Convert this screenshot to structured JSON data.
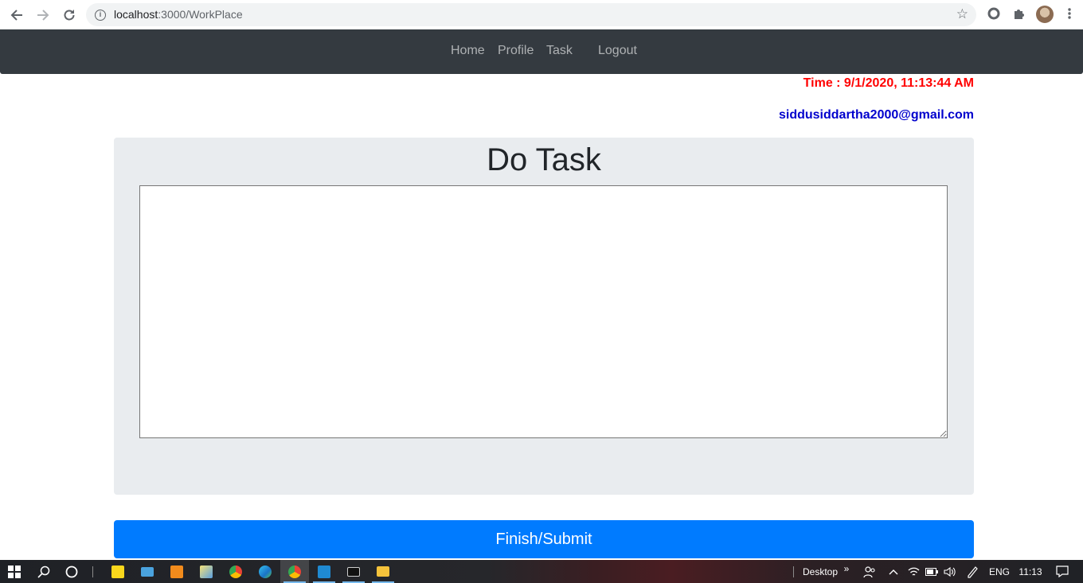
{
  "browser": {
    "url_host": "localhost",
    "url_path": ":3000/WorkPlace"
  },
  "navbar": {
    "links": [
      "Home",
      "Profile",
      "Task",
      "Logout"
    ]
  },
  "status": {
    "time": "Time : 9/1/2020, 11:13:44 AM",
    "email": "siddusiddartha2000@gmail.com"
  },
  "task": {
    "heading": "Do Task",
    "textarea_value": ""
  },
  "submit": {
    "label": "Finish/Submit"
  },
  "colors": {
    "navbar_bg": "#343a40",
    "time_color": "#ff0000",
    "email_color": "#0000cd",
    "primary": "#007bff",
    "jumbotron_bg": "#e9ecef"
  },
  "taskbar": {
    "apps": [
      "sticky-notes-icon",
      "this-pc-icon",
      "sublime-text-icon",
      "paint-icon",
      "chrome-icon",
      "edge-icon",
      "chrome-icon",
      "vscode-icon",
      "cmd-icon",
      "file-explorer-icon"
    ],
    "desktop_label": "Desktop",
    "language": "ENG",
    "clock": "11:13"
  }
}
